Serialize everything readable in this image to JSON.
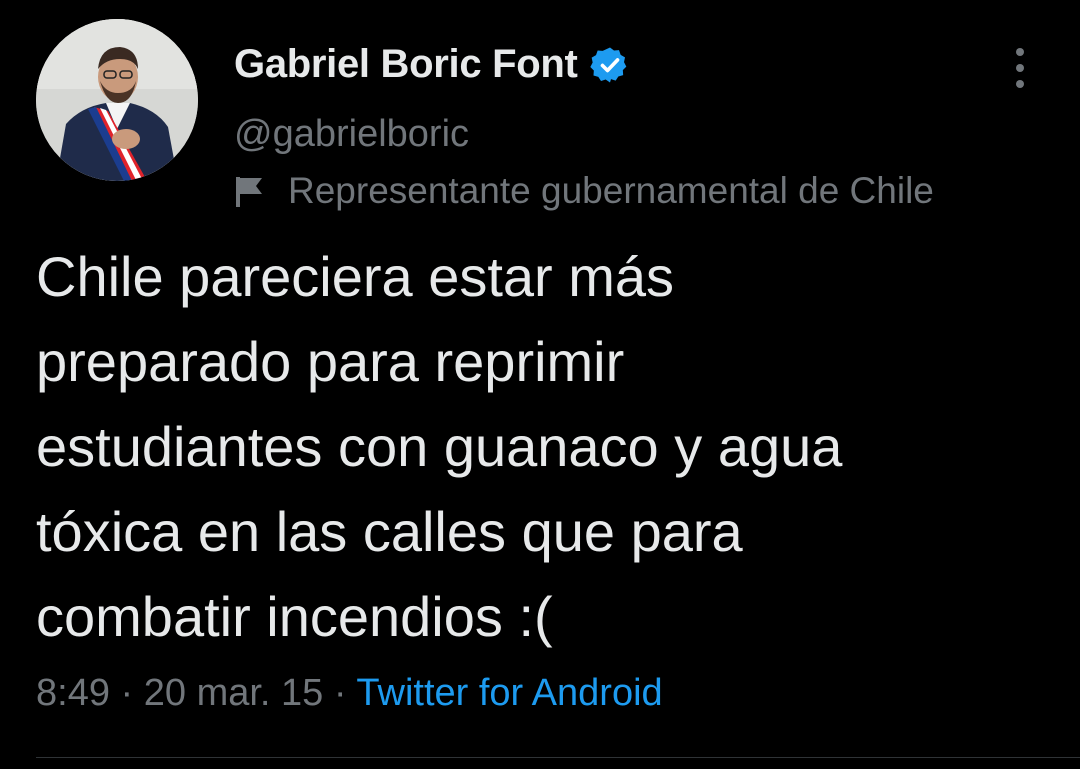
{
  "author": {
    "display_name": "Gabriel Boric Font",
    "handle": "@gabrielboric",
    "verified": true,
    "avatar_icon": "profile-photo"
  },
  "account_label": {
    "icon": "flag-icon",
    "text": "Representante gubernamental de Chile"
  },
  "tweet": {
    "text": "Chile pareciera estar más\npreparado para reprimir\nestudiantes con guanaco y agua\ntóxica en las calles que para\ncombatir incendios :(",
    "time": "8:49",
    "separator": " · ",
    "date": "20 mar. 15",
    "source": "Twitter for Android"
  },
  "colors": {
    "background": "#000000",
    "primary_text": "#e7e9ea",
    "secondary_text": "#71767b",
    "accent": "#1d9bf0",
    "divider": "#2f3336"
  }
}
